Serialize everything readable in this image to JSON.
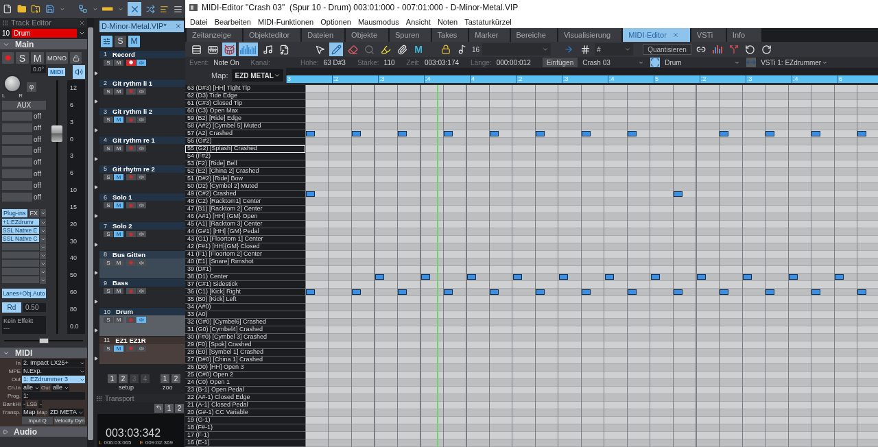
{
  "track_editor": {
    "title": "Track Editor",
    "track_number": "10",
    "track_name": "Drum",
    "section": "Main",
    "buttons": [
      {
        "kind": "record",
        "on": false
      },
      {
        "kind": "text",
        "label": "S",
        "on": false
      },
      {
        "kind": "text",
        "label": "M",
        "on": false
      },
      {
        "kind": "text",
        "label": "MONO",
        "on": false
      },
      {
        "kind": "lock",
        "on": false
      }
    ],
    "pan_reading": "0.0°",
    "midi_badge": "MIDI",
    "knob_left": "L",
    "knob_right": "R",
    "phase": "φ",
    "aux": "AUX",
    "aux_sends": [
      "off",
      "off",
      "off",
      "off",
      "off",
      "off",
      "off",
      "off"
    ],
    "scale": [
      "12",
      "6",
      "3",
      "0",
      "3",
      "6",
      "10",
      "15",
      "20",
      "30",
      "40",
      "50",
      "60",
      "80"
    ],
    "volume_reading": "0.0",
    "volume_fader": {
      "level": 0.79
    },
    "plugins_tab": "Plug-ins",
    "fx_tab": "FX",
    "slots": [
      {
        "kind": "filled",
        "label": "+1:EZdrumr"
      },
      {
        "kind": "filled",
        "label": "SSL Native E"
      },
      {
        "kind": "filled",
        "label": "SSL Native C"
      },
      {
        "kind": "empty"
      },
      {
        "kind": "empty"
      },
      {
        "kind": "empty"
      },
      {
        "kind": "empty"
      },
      {
        "kind": "empty"
      }
    ],
    "lanes": "Lanes+Obj.Auto",
    "rd": "Rd",
    "rd_value": "0.50",
    "effect": "Kein Effekt",
    "effect_sub": "---",
    "bottom_slider": {
      "level": 0.5
    },
    "midi": {
      "title": "MIDI",
      "in_label": "In",
      "in": "2. Impact LX25+",
      "mpe_label": "MPE",
      "mpe": "N.Exp.",
      "out_label": "Out",
      "out": "1: EZdrummer 3",
      "chin_label": "Ch.In",
      "chin": "alle",
      "chout_label": "Out",
      "chout": "alle",
      "prog_label": "Prog.",
      "prog": "1:",
      "bankhi_label": "BankHi",
      "bankhi": "-",
      "lsb_label": "LSB",
      "lsb": "-",
      "transp_label": "Transp.",
      "transp": "Map",
      "map_label": "Map",
      "map": "ZD META",
      "buttons": [
        "Input Q",
        "Velocity Dyn"
      ]
    },
    "audio": "Audio"
  },
  "track_list": {
    "tab": "D-Minor-Metal.VIP*",
    "solo_all": {
      "label": "S",
      "on": false
    },
    "mute_all": {
      "label": "M",
      "on": true
    },
    "tracks": [
      {
        "number": "1",
        "name": "Record",
        "kind": "audio",
        "selected": false,
        "solo": {
          "label": "S",
          "on": false
        },
        "mute": {
          "label": "M",
          "on": false
        },
        "record": true,
        "monitor": true
      },
      {
        "number": "2",
        "name": "Git rythm li 1",
        "kind": "audio",
        "selected": false,
        "solo": {
          "label": "S",
          "on": false
        },
        "mute": {
          "label": "M",
          "on": false
        },
        "record": false,
        "monitor": false
      },
      {
        "number": "3",
        "name": "Git rythm li 2",
        "kind": "audio",
        "selected": false,
        "solo": {
          "label": "S",
          "on": false
        },
        "mute": {
          "label": "M",
          "on": true
        },
        "record": false,
        "monitor": false
      },
      {
        "number": "4",
        "name": "Git rythm re 1",
        "kind": "audio",
        "selected": false,
        "solo": {
          "label": "S",
          "on": false
        },
        "mute": {
          "label": "M",
          "on": false
        },
        "record": false,
        "monitor": false
      },
      {
        "number": "5",
        "name": "Git rhytm re 2",
        "kind": "audio",
        "selected": false,
        "solo": {
          "label": "S",
          "on": false
        },
        "mute": {
          "label": "M",
          "on": true
        },
        "record": false,
        "monitor": false
      },
      {
        "number": "6",
        "name": "Solo 1",
        "kind": "audio",
        "selected": false,
        "solo": {
          "label": "S",
          "on": false
        },
        "mute": {
          "label": "M",
          "on": true
        },
        "record": false,
        "monitor": false
      },
      {
        "number": "7",
        "name": "Solo 2",
        "kind": "audio",
        "selected": false,
        "solo": {
          "label": "S",
          "on": false
        },
        "mute": {
          "label": "M",
          "on": true
        },
        "record": false,
        "monitor": false
      },
      {
        "number": "8",
        "name": "Bus Gitten",
        "kind": "bus",
        "selected": false,
        "solo": {
          "label": "S",
          "on": false
        },
        "mute": {
          "label": "M",
          "on": false
        },
        "record": false,
        "monitor": false
      },
      {
        "number": "9",
        "name": "Bass",
        "kind": "audio",
        "selected": false,
        "solo": {
          "label": "S",
          "on": false
        },
        "mute": {
          "label": "M",
          "on": false
        },
        "record": false,
        "monitor": false
      },
      {
        "number": "10",
        "name": "Drum",
        "kind": "audio",
        "selected": true,
        "solo": {
          "label": "S",
          "on": false
        },
        "mute": {
          "label": "M",
          "on": false
        },
        "record": false,
        "monitor": true
      },
      {
        "number": "11",
        "name": "EZ1 EZ1R",
        "kind": "instrument",
        "selected": false,
        "solo": {
          "label": "S",
          "on": false
        },
        "mute": {
          "label": "M",
          "on": true
        },
        "record": false,
        "monitor": false
      }
    ],
    "setup_buttons": [
      {
        "label": "1",
        "disabled": false
      },
      {
        "label": "2",
        "disabled": false
      },
      {
        "label": "3",
        "disabled": true
      },
      {
        "label": "4",
        "disabled": true
      }
    ],
    "setup_label": "setup",
    "zoom_buttons": [
      "1",
      "2"
    ],
    "zoom_label": "zoo"
  },
  "transport": {
    "title": "Transport",
    "buttons": [
      "1",
      "2"
    ],
    "time": "003:03:342",
    "left_label": "L",
    "left": "006:03:065",
    "end_label": "E",
    "end": "009:02:369"
  },
  "editor": {
    "title": "MIDI-Editor \"Crash 03\"  (Spur 10 - Drum) 003:01:000 - 007:01:000 - D-Minor-Metal.VIP",
    "menu": [
      "Datei",
      "Bearbeiten",
      "MIDI-Funktionen",
      "Optionen",
      "Mausmodus",
      "Ansicht",
      "Noten",
      "Tastaturkürzel"
    ],
    "tabs": [
      {
        "label": "Zeitanzeige",
        "selected": false
      },
      {
        "label": "Objekteditor",
        "selected": false
      },
      {
        "label": "Dateien",
        "selected": false
      },
      {
        "label": "Objekte",
        "selected": false
      },
      {
        "label": "Spuren",
        "selected": false
      },
      {
        "label": "Takes",
        "selected": false
      },
      {
        "label": "Marker",
        "selected": false
      },
      {
        "label": "Bereiche",
        "selected": false
      },
      {
        "label": "Visualisierung",
        "selected": false
      },
      {
        "label": "MIDI-Editor",
        "selected": true
      },
      {
        "label": "VSTi",
        "selected": false
      },
      {
        "label": "Info",
        "selected": false
      }
    ],
    "views": [
      {
        "kind": "list",
        "selected": false
      },
      {
        "kind": "piano",
        "selected": false
      },
      {
        "kind": "drum",
        "selected": true
      },
      {
        "kind": "velocity",
        "selected": true
      },
      {
        "kind": "score",
        "selected": false
      },
      {
        "kind": "page",
        "selected": false
      }
    ],
    "tools": [
      {
        "kind": "pointer",
        "selected": false
      },
      {
        "kind": "pencil",
        "selected": true
      },
      {
        "kind": "eraser",
        "selected": false
      },
      {
        "kind": "zoom",
        "selected": false
      },
      {
        "kind": "highlighter",
        "selected": false
      },
      {
        "kind": "glue",
        "selected": false
      },
      {
        "kind": "mute",
        "label": "M",
        "selected": false
      }
    ],
    "grid_value": "16",
    "snap_symbol": "#",
    "quantize": "Quantisieren",
    "info": [
      {
        "label": "Event:",
        "value": "Note On"
      },
      {
        "label": "Kanal:"
      },
      {
        "label": "Höhe:",
        "value": "63 D#3"
      },
      {
        "label": "Stärke:",
        "value": "110"
      },
      {
        "label": "Zeit:",
        "value": "003:03:174"
      },
      {
        "label": "Länge:",
        "value": "000:00:012"
      }
    ],
    "insert": "Einfügen",
    "object": "Crash 03",
    "track": "Drum",
    "instrument": "VSTi 1: EZdrummer",
    "map_label": "Map:",
    "map": "EZD METAL",
    "ruler": [
      "3",
      ":2",
      ":3",
      ":4",
      "4",
      ":2",
      ":3",
      ":4",
      "5",
      ":2",
      ":3",
      ":4",
      "6"
    ],
    "rows": [
      {
        "label": "63 (D#3) [HH] Tight Tip",
        "selected": false
      },
      {
        "label": "62 (D3) Tide Edge",
        "selected": false
      },
      {
        "label": "61 (C#3) Closed Tip",
        "selected": false
      },
      {
        "label": "60 (C3) Open Max",
        "selected": false
      },
      {
        "label": "59 (B2) [Ride] Edge",
        "selected": false
      },
      {
        "label": "58 (A#2) [Cymbel 5] Muted",
        "selected": false
      },
      {
        "label": "57 (A2) Crashed",
        "selected": false
      },
      {
        "label": "56 (G#2)",
        "selected": false
      },
      {
        "label": "55 (G2) [Splash] Crashed",
        "selected": true
      },
      {
        "label": "54 (F#2)",
        "selected": false
      },
      {
        "label": "53 (F2) [Ride] Bell",
        "selected": false
      },
      {
        "label": "52 (E2) [China 2] Crashed",
        "selected": false
      },
      {
        "label": "51 (D#2) [Ride] Bow",
        "selected": false
      },
      {
        "label": "50 (D2) [Cymbel 2] Muted",
        "selected": false
      },
      {
        "label": "49 (C#2) Crashed",
        "selected": false
      },
      {
        "label": "48 (C2) [Racktom1] Center",
        "selected": false
      },
      {
        "label": "47 (B1) [Racktom 2] Center",
        "selected": false
      },
      {
        "label": "46 (A#1) [HH] {GM} Open",
        "selected": false
      },
      {
        "label": "45 (A1) [Racktom 3] Center",
        "selected": false
      },
      {
        "label": "44 (G#1) [HH] {GM} Pedal",
        "selected": false
      },
      {
        "label": "43 (G1) [Floortom 1] Center",
        "selected": false
      },
      {
        "label": "42 (F#1) [HH]{GM} Closed",
        "selected": false
      },
      {
        "label": "41 (F1) [Floortom 2] Center",
        "selected": false
      },
      {
        "label": "40 (E1) [Snare] Rimshot",
        "selected": false
      },
      {
        "label": "39 (D#1)",
        "selected": false
      },
      {
        "label": "38 (D1) Center",
        "selected": false
      },
      {
        "label": "37 (C#1) Sidestick",
        "selected": false
      },
      {
        "label": "36 (C1) [Kick] Right",
        "selected": false
      },
      {
        "label": "35 (B0) [Kick] Left",
        "selected": false
      },
      {
        "label": "34 (A#0)",
        "selected": false
      },
      {
        "label": "33 (A0)",
        "selected": false
      },
      {
        "label": "32 (G#0) [Cymbel6] Crashed",
        "selected": false
      },
      {
        "label": "31 (G0) [Cymbel4] Crashed",
        "selected": false
      },
      {
        "label": "30 (F#0) [Cymbel 3] Crashed",
        "selected": false
      },
      {
        "label": "29 (F0) [Spok] Crashed",
        "selected": false
      },
      {
        "label": "28 (E0) [Symbel 1] Crashed",
        "selected": false
      },
      {
        "label": "27 (D#0) [China 1] Crashed",
        "selected": false
      },
      {
        "label": "26 (D0) [HH] Open 3",
        "selected": false
      },
      {
        "label": "25 (C#0) Open 2",
        "selected": false
      },
      {
        "label": "24 (C0) Open 1",
        "selected": false
      },
      {
        "label": "23 (B-1) Open Pedal",
        "selected": false
      },
      {
        "label": "22 (A#-1) Closed Edge",
        "selected": false
      },
      {
        "label": "21 (A-1) Closed Pedal",
        "selected": false
      },
      {
        "label": "20 (G#-1) CC Variable",
        "selected": false
      },
      {
        "label": "19 (G-1)",
        "selected": false
      },
      {
        "label": "18 (F#-1)",
        "selected": false
      },
      {
        "label": "17 (F-1)",
        "selected": false
      },
      {
        "label": "16 (E-1)",
        "selected": false
      }
    ]
  }
}
